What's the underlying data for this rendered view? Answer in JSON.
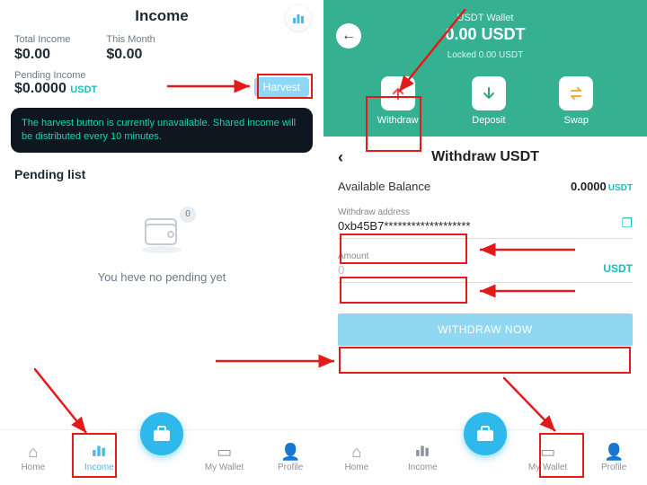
{
  "left": {
    "title": "Income",
    "total_label": "Total Income",
    "total_value": "$0.00",
    "month_label": "This Month",
    "month_value": "$0.00",
    "pending_label": "Pending Income",
    "pending_value": "$0.0000",
    "pending_currency": "USDT",
    "harvest_label": "Harvest",
    "banner": "The harvest button is currently unavailable. Shared income will be distributed every 10 minutes.",
    "pending_list_title": "Pending list",
    "empty_badge": "0",
    "empty_text": "You heve no pending yet"
  },
  "right": {
    "wallet_label": "USDT Wallet",
    "balance": "0.00 USDT",
    "locked": "Locked 0.00 USDT",
    "actions": {
      "withdraw": "Withdraw",
      "deposit": "Deposit",
      "swap": "Swap"
    },
    "page_title": "Withdraw USDT",
    "available_label": "Available Balance",
    "available_value": "0.0000",
    "available_unit": "USDT",
    "addr_label": "Withdraw address",
    "addr_value": "0xb45B7*******************",
    "amount_label": "Amount",
    "amount_placeholder": "0",
    "amount_suffix": "USDT",
    "withdraw_btn": "WITHDRAW NOW"
  },
  "nav": {
    "home": "Home",
    "income": "Income",
    "wallet": "My Wallet",
    "profile": "Profile"
  }
}
